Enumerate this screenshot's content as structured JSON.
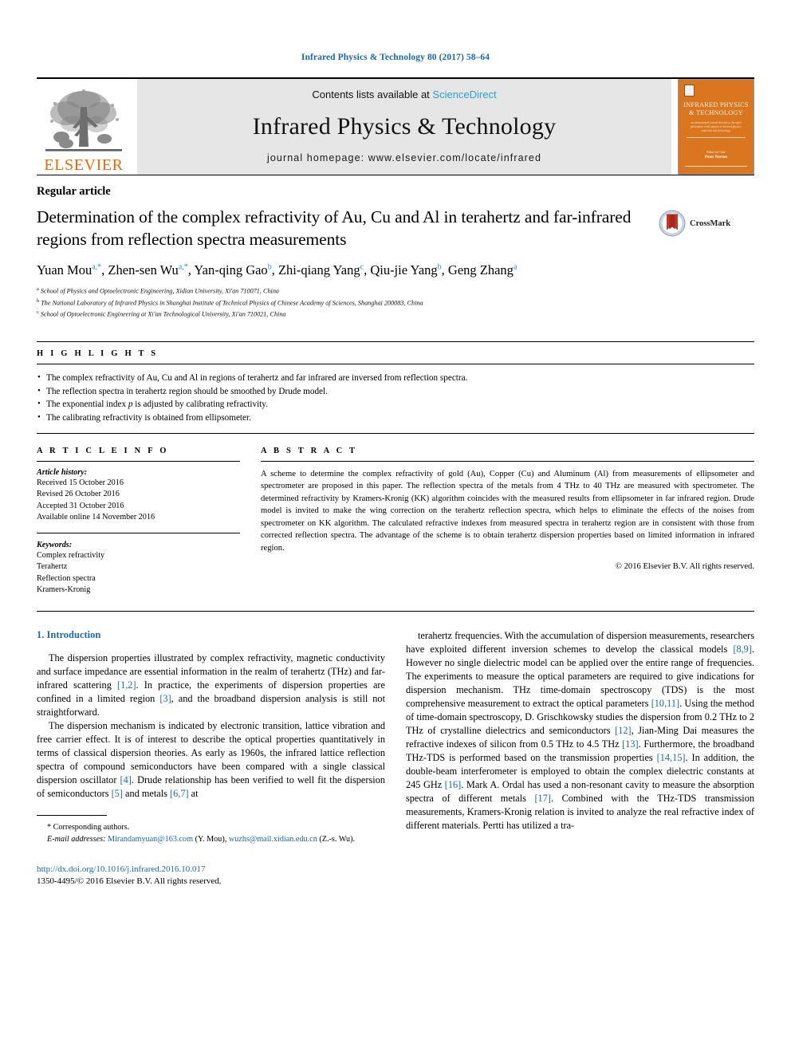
{
  "running_head": "Infrared Physics & Technology 80 (2017) 58–64",
  "masthead": {
    "publisher_name": "ELSEVIER",
    "contents_prefix": "Contents lists available at ",
    "contents_link": "ScienceDirect",
    "journal_title": "Infrared Physics & Technology",
    "homepage": "journal homepage: www.elsevier.com/locate/infrared",
    "cover": {
      "title_line1": "INFRARED PHYSICS",
      "title_line2": "& TECHNOLOGY",
      "subtitle": "an international journal devoted to the rapid publication of all aspects of infrared physics, materials and technology",
      "foot_small": "Editor-in-Chief",
      "foot_bold": "Peter Norton"
    }
  },
  "article": {
    "kind": "Regular article",
    "title": "Determination of the complex refractivity of Au, Cu and Al in terahertz and far-infrared regions from reflection spectra measurements",
    "crossmark_label": "CrossMark",
    "authors": [
      {
        "name": "Yuan Mou",
        "sup": "a,*"
      },
      {
        "name": "Zhen-sen Wu",
        "sup": "a,*"
      },
      {
        "name": "Yan-qing Gao",
        "sup": "b"
      },
      {
        "name": "Zhi-qiang Yang",
        "sup": "c"
      },
      {
        "name": "Qiu-jie Yang",
        "sup": "b"
      },
      {
        "name": "Geng Zhang",
        "sup": "a"
      }
    ],
    "affiliations": [
      {
        "sup": "a",
        "text": "School of Physics and Optoelectronic Engineering, Xidian University, Xi'an 710071, China"
      },
      {
        "sup": "b",
        "text": "The National Laboratory of Infrared Physics in Shanghai Institute of Technical Physics of Chinese Academy of Sciences, Shanghai 200083, China"
      },
      {
        "sup": "c",
        "text": "School of Optoelectronic Engineering at Xi'an Technological University, Xi'an 710021, China"
      }
    ]
  },
  "highlights": {
    "label": "H I G H L I G H T S",
    "items": [
      "The complex refractivity of Au, Cu and Al in regions of terahertz and far infrared are inversed from reflection spectra.",
      "The reflection spectra in terahertz region should be smoothed by Drude model.",
      "The exponential index p is adjusted by calibrating refractivity.",
      "The calibrating refractivity is obtained from ellipsometer."
    ]
  },
  "article_info": {
    "label": "A R T I C L E    I N F O",
    "history_title": "Article history:",
    "history": [
      "Received 15 October 2016",
      "Revised 26 October 2016",
      "Accepted 31 October 2016",
      "Available online 14 November 2016"
    ],
    "keywords_title": "Keywords:",
    "keywords": [
      "Complex refractivity",
      "Terahertz",
      "Reflection spectra",
      "Kramers-Kronig"
    ]
  },
  "abstract": {
    "label": "A B S T R A C T",
    "text": "A scheme to determine the complex refractivity of gold (Au), Copper (Cu) and Aluminum (Al) from measurements of ellipsometer and spectrometer are proposed in this paper. The reflection spectra of the metals from 4 THz to 40 THz are measured with spectrometer. The determined refractivity by Kramers-Kronig (KK) algorithm coincides with the measured results from ellipsometer in far infrared region. Drude model is invited to make the wing correction on the terahertz reflection spectra, which helps to eliminate the effects of the noises from spectrometer on KK algorithm. The calculated refractive indexes from measured spectra in terahertz region are in consistent with those from corrected reflection spectra. The advantage of the scheme is to obtain terahertz dispersion properties based on limited information in infrared region.",
    "copyright": "© 2016 Elsevier B.V. All rights reserved."
  },
  "body": {
    "section_title": "1. Introduction",
    "left_paragraphs": [
      "The dispersion properties illustrated by complex refractivity, magnetic conductivity and surface impedance are essential information in the realm of terahertz (THz) and far-infrared scattering [1,2]. In practice, the experiments of dispersion properties are confined in a limited region [3], and the broadband dispersion analysis is still not straightforward.",
      "The dispersion mechanism is indicated by electronic transition, lattice vibration and free carrier effect. It is of interest to describe the optical properties quantitatively in terms of classical dispersion theories. As early as 1960s, the infrared lattice reflection spectra of compound semiconductors have been compared with a single classical dispersion oscillator [4]. Drude relationship has been verified to well fit the dispersion of semiconductors [5] and metals [6,7] at"
    ],
    "right_paragraphs": [
      "terahertz frequencies. With the accumulation of dispersion measurements, researchers have exploited different inversion schemes to develop the classical models [8,9]. However no single dielectric model can be applied over the entire range of frequencies. The experiments to measure the optical parameters are required to give indications for dispersion mechanism. THz time-domain spectroscopy (TDS) is the most comprehensive measurement to extract the optical parameters [10,11]. Using the method of time-domain spectroscopy, D. Grischkowsky studies the dispersion from 0.2 THz to 2 THz of crystalline dielectrics and semiconductors [12], Jian-Ming Dai measures the refractive indexes of silicon from 0.5 THz to 4.5 THz [13]. Furthermore, the broadband THz-TDS is performed based on the transmission properties [14,15]. In addition, the double-beam interferometer is employed to obtain the complex dielectric constants at 245 GHz [16]. Mark A. Ordal has used a non-resonant cavity to measure the absorption spectra of different metals [17]. Combined with the THz-TDS transmission measurements, Kramers-Kronig relation is invited to analyze the real refractive index of different materials. Pertti has utilized a tra-"
    ]
  },
  "footnote": {
    "corresponding": "* Corresponding authors.",
    "email_label": "E-mail addresses:",
    "email1": "Mirandamyuan@163.com",
    "email1_who": "(Y. Mou),",
    "email2": "wuzhs@mail.xidian.edu.cn",
    "email2_who": "(Z.-s. Wu)."
  },
  "imprint": {
    "doi": "http://dx.doi.org/10.1016/j.infrared.2016.10.017",
    "issn": "1350-4495/© 2016 Elsevier B.V. All rights reserved."
  },
  "colors": {
    "link_blue": "#1a6aa8",
    "sciencedirect_blue": "#2a9fd6",
    "elsevier_orange": "#eb6608",
    "cover_orange": "#d9761f",
    "band_grey": "#e6e6e6"
  }
}
